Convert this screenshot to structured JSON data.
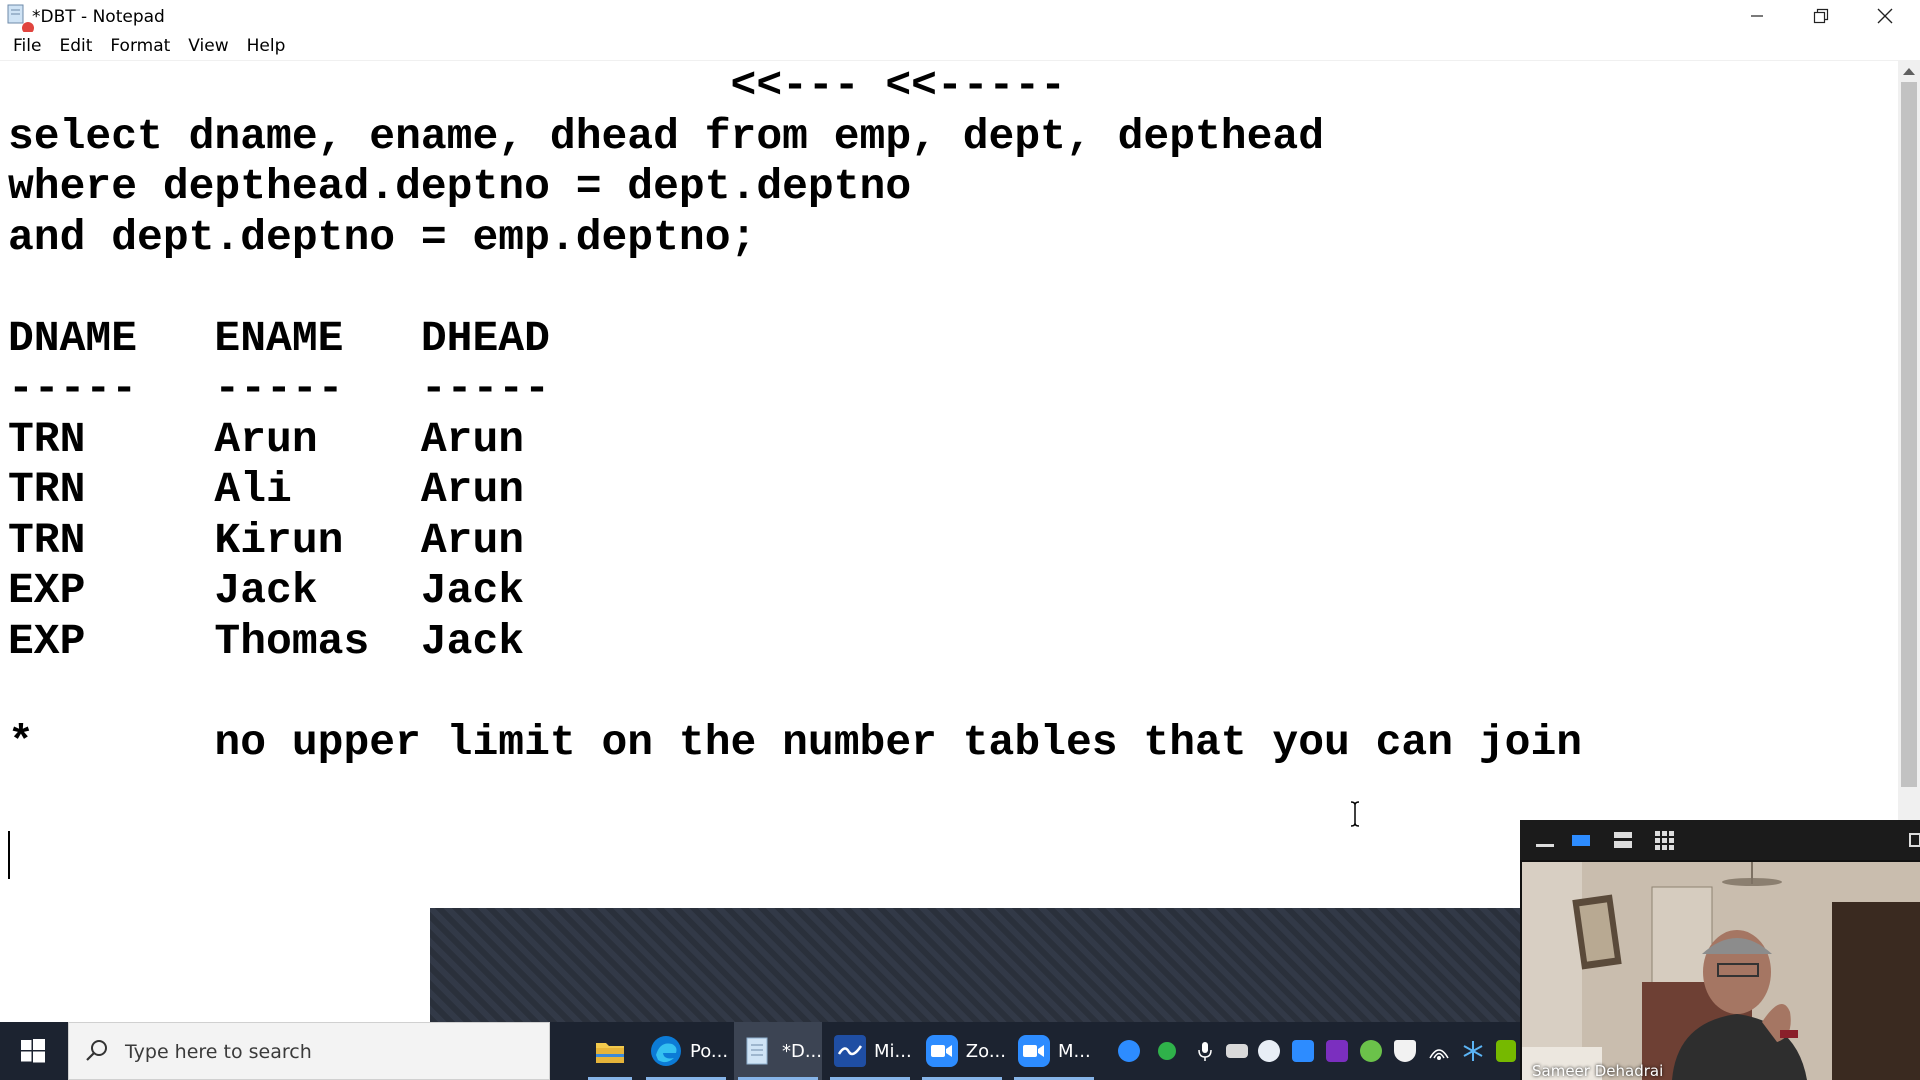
{
  "window": {
    "title": "*DBT - Notepad"
  },
  "menu": {
    "items": [
      {
        "label": "File"
      },
      {
        "label": "Edit"
      },
      {
        "label": "Format"
      },
      {
        "label": "View"
      },
      {
        "label": "Help"
      }
    ]
  },
  "editor": {
    "lines": [
      "                            <<--- <<-----",
      "select dname, ename, dhead from emp, dept, depthead",
      "where depthead.deptno = dept.deptno",
      "and dept.deptno = emp.deptno;",
      "",
      "DNAME   ENAME   DHEAD",
      "-----   -----   -----",
      "TRN     Arun    Arun",
      "TRN     Ali     Arun",
      "TRN     Kirun   Arun",
      "EXP     Jack    Jack",
      "EXP     Thomas  Jack",
      "",
      "*       no upper limit on the number tables that you can join",
      ""
    ]
  },
  "taskbar": {
    "search_placeholder": "Type here to search",
    "apps": [
      {
        "name": "file-explorer",
        "label": ""
      },
      {
        "name": "edge",
        "label": "Po..."
      },
      {
        "name": "notepad",
        "label": "*D..."
      },
      {
        "name": "whiteboard",
        "label": "Mi..."
      },
      {
        "name": "zoom",
        "label": "Zo..."
      },
      {
        "name": "zoom-meeting",
        "label": "M..."
      }
    ]
  },
  "video": {
    "speaker_name": "Sameer Dehadrai"
  },
  "colors": {
    "taskbar_bg": "#1c2330",
    "zoom_blue": "#2d8cff",
    "edge_blue": "#0c7bd6"
  }
}
